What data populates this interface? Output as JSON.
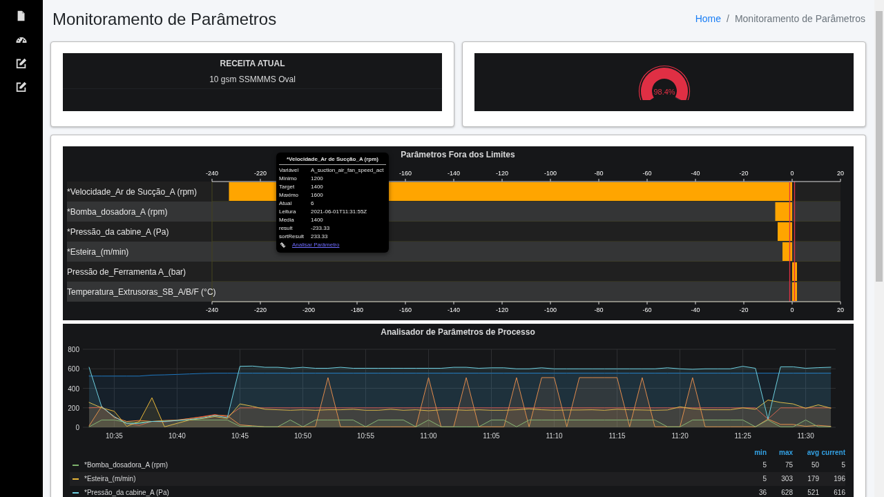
{
  "sidebar": {
    "items": [
      {
        "kind": "file"
      },
      {
        "kind": "gauge"
      },
      {
        "kind": "edit"
      },
      {
        "kind": "edit"
      }
    ]
  },
  "page": {
    "title": "Monitoramento de Parâmetros"
  },
  "breadcrumb": {
    "separator": "/",
    "items": [
      {
        "label": "Home",
        "active": false
      },
      {
        "label": "Monitoramento de Parâmetros",
        "active": true
      }
    ]
  },
  "recipe": {
    "heading": "RECEITA ATUAL",
    "value": "10 gsm SSMMMS Oval"
  },
  "gauge": {
    "level": 0.984,
    "reading": "98.4%"
  },
  "limits_panel": {
    "title": "Parâmetros Fora dos Limites",
    "top_axis": [
      "-240",
      "-220",
      "-160",
      "-140",
      "-120",
      "-100",
      "-80",
      "-60",
      "-40",
      "-20",
      "0",
      "20"
    ],
    "chart_data": {
      "type": "bar",
      "orientation": "horizontal",
      "categories": [
        "*Velocidade_Ar de Sucção_A (rpm)",
        "*Bomba_dosadora_A (rpm)",
        "*Pressão_da cabine_A (Pa)",
        "*Esteira_(m/min)",
        "Pressão de_Ferramenta A_(bar)",
        "Temperatura_Extrusoras_SB_A/B/F (°C)"
      ],
      "series": [
        {
          "color": "#ffa500",
          "values": [
            -233,
            -7,
            -6,
            -4,
            2,
            2
          ]
        }
      ],
      "xlim": [
        -240,
        20
      ],
      "xticks": [
        -240,
        -220,
        -200,
        -180,
        -160,
        -140,
        -120,
        -100,
        -80,
        -60,
        -40,
        -20,
        0,
        20
      ],
      "ref_lines": [
        {
          "axis": "x",
          "value": -1,
          "color": "#e02f44"
        },
        {
          "axis": "x",
          "value": 1,
          "color": "#e02f44"
        }
      ]
    },
    "tooltip": {
      "title": "*Velocidade_Ar de Sucção_A (rpm)",
      "rows": [
        {
          "label": "Variável",
          "value": "A_suction_air_fan_speed_act"
        },
        {
          "label": "Minimo",
          "value": "1200"
        },
        {
          "label": "Target",
          "value": "1400"
        },
        {
          "label": "Maximo",
          "value": "1600"
        },
        {
          "label": "Atual",
          "value": "6"
        },
        {
          "label": "Leitura",
          "value": "2021-06-01T11:31:55Z"
        },
        {
          "label": "Media",
          "value": "1400"
        },
        {
          "label": "result",
          "value": "-233.33"
        },
        {
          "label": "sortResult",
          "value": "233.33"
        }
      ],
      "link": "Analisar Parâmetro"
    }
  },
  "process_panel": {
    "title": "Analisador de Parâmetros de Processo",
    "chart_data": {
      "type": "area",
      "grid": true,
      "categories": [
        null,
        null,
        "10:35",
        null,
        null,
        null,
        null,
        "10:40",
        null,
        null,
        null,
        null,
        "10:45",
        null,
        null,
        null,
        null,
        "10:50",
        null,
        null,
        null,
        null,
        "10:55",
        null,
        null,
        null,
        null,
        "11:00",
        null,
        null,
        null,
        null,
        "11:05",
        null,
        null,
        null,
        null,
        "11:10",
        null,
        null,
        null,
        null,
        "11:15",
        null,
        null,
        null,
        null,
        "11:20",
        null,
        null,
        null,
        null,
        "11:25",
        null,
        null,
        null,
        null,
        "11:30",
        null,
        null
      ],
      "ylim": [
        0,
        800
      ],
      "yticks": [
        0,
        200,
        400,
        600,
        800
      ],
      "series": [
        {
          "color": "#1f78c1",
          "values": [
            525,
            525,
            525,
            525,
            525,
            535,
            538,
            542,
            547,
            552,
            555,
            555,
            555,
            555,
            555,
            555,
            555,
            555,
            555,
            555,
            555,
            555,
            555,
            555,
            555,
            555,
            555,
            555,
            555,
            555,
            555,
            555,
            555,
            555,
            555,
            555,
            555,
            555,
            555,
            555,
            555,
            555,
            555,
            555,
            555,
            555,
            555,
            555,
            555,
            555,
            555,
            555,
            555,
            555,
            555,
            555,
            555,
            555,
            555,
            555
          ]
        },
        {
          "color": "#e24d42",
          "values": [
            200,
            205,
            110,
            40,
            20,
            60,
            55,
            70,
            90,
            110,
            130,
            110,
            200,
            200,
            200,
            200,
            200,
            200,
            200,
            200,
            200,
            200,
            200,
            200,
            200,
            200,
            200,
            200,
            200,
            200,
            200,
            200,
            200,
            200,
            200,
            200,
            200,
            200,
            200,
            200,
            200,
            200,
            200,
            200,
            200,
            200,
            200,
            200,
            200,
            200,
            200,
            200,
            200,
            200,
            85,
            200,
            200,
            200,
            200,
            200
          ]
        },
        {
          "color": "#ef843c",
          "values": [
            15,
            215,
            100,
            60,
            70,
            60,
            70,
            75,
            90,
            105,
            125,
            120,
            25,
            15,
            5,
            5,
            5,
            5,
            5,
            510,
            5,
            5,
            5,
            5,
            5,
            5,
            5,
            510,
            5,
            5,
            510,
            5,
            5,
            5,
            510,
            5,
            510,
            510,
            5,
            510,
            510,
            510,
            510,
            5,
            510,
            5,
            5,
            5,
            510,
            5,
            5,
            5,
            5,
            5,
            85,
            30,
            30,
            10,
            20,
            10
          ]
        },
        {
          "color": "#7eb26d",
          "values": [
            5,
            75,
            75,
            50,
            50,
            60,
            65,
            70,
            75,
            75,
            75,
            75,
            10,
            10,
            5,
            5,
            75,
            5,
            75,
            75,
            75,
            75,
            5,
            75,
            75,
            75,
            5,
            75,
            5,
            5,
            5,
            5,
            75,
            75,
            5,
            75,
            75,
            75,
            75,
            75,
            75,
            75,
            75,
            75,
            75,
            75,
            5,
            5,
            75,
            75,
            75,
            75,
            75,
            5,
            75,
            5,
            5,
            75,
            5,
            5
          ]
        },
        {
          "color": "#eab839",
          "values": [
            255,
            200,
            165,
            10,
            60,
            303,
            5,
            40,
            75,
            90,
            110,
            90,
            240,
            215,
            185,
            180,
            175,
            180,
            175,
            180,
            180,
            185,
            175,
            175,
            185,
            175,
            180,
            170,
            180,
            180,
            175,
            180,
            175,
            175,
            180,
            190,
            180,
            175,
            178,
            178,
            180,
            175,
            185,
            180,
            178,
            175,
            178,
            210,
            190,
            180,
            180,
            180,
            200,
            185,
            280,
            255,
            240,
            195,
            230,
            196
          ]
        },
        {
          "color": "#6ed0e0",
          "values": [
            616,
            210,
            110,
            36,
            40,
            60,
            60,
            70,
            80,
            95,
            120,
            100,
            625,
            628,
            615,
            615,
            605,
            615,
            605,
            605,
            615,
            605,
            605,
            605,
            605,
            605,
            605,
            605,
            605,
            615,
            615,
            605,
            610,
            610,
            600,
            600,
            610,
            600,
            600,
            600,
            600,
            600,
            600,
            600,
            600,
            600,
            610,
            600,
            595,
            600,
            600,
            600,
            625,
            605,
            85,
            620,
            620,
            605,
            612,
            616
          ]
        }
      ]
    },
    "legend": {
      "columns": [
        "min",
        "max",
        "avg",
        "current"
      ],
      "rows": [
        {
          "name": "*Bomba_dosadora_A (rpm)",
          "color": "#7eb26d",
          "stats": [
            "5",
            "75",
            "50",
            "5"
          ]
        },
        {
          "name": "*Esteira_(m/min)",
          "color": "#eab839",
          "stats": [
            "5",
            "303",
            "179",
            "196"
          ]
        },
        {
          "name": "*Pressão_da cabine_A (Pa)",
          "color": "#6ed0e0",
          "stats": [
            "36",
            "628",
            "521",
            "616"
          ]
        }
      ]
    }
  }
}
